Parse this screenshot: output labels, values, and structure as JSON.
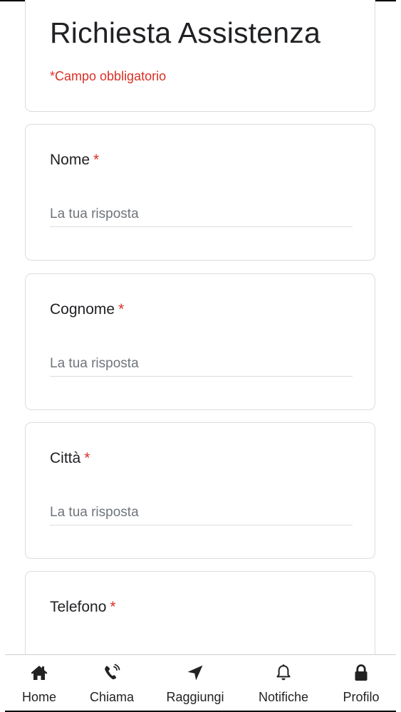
{
  "form": {
    "title": "Richiesta Assistenza",
    "required_note": "*Campo obbligatorio",
    "questions": [
      {
        "label": "Nome",
        "required_mark": "*",
        "placeholder": "La tua risposta"
      },
      {
        "label": "Cognome",
        "required_mark": "*",
        "placeholder": "La tua risposta"
      },
      {
        "label": "Città",
        "required_mark": "*",
        "placeholder": "La tua risposta"
      },
      {
        "label": "Telefono",
        "required_mark": "*",
        "placeholder": ""
      }
    ]
  },
  "bottom_nav": {
    "items": [
      {
        "label": "Home",
        "icon": "home-icon"
      },
      {
        "label": "Chiama",
        "icon": "phone-ringing-icon"
      },
      {
        "label": "Raggiungi",
        "icon": "location-arrow-icon"
      },
      {
        "label": "Notifiche",
        "icon": "bell-icon"
      },
      {
        "label": "Profilo",
        "icon": "lock-icon"
      }
    ]
  },
  "colors": {
    "required": "#d93025",
    "text": "#202124",
    "placeholder": "#70757a",
    "card_border": "#dadce0"
  }
}
